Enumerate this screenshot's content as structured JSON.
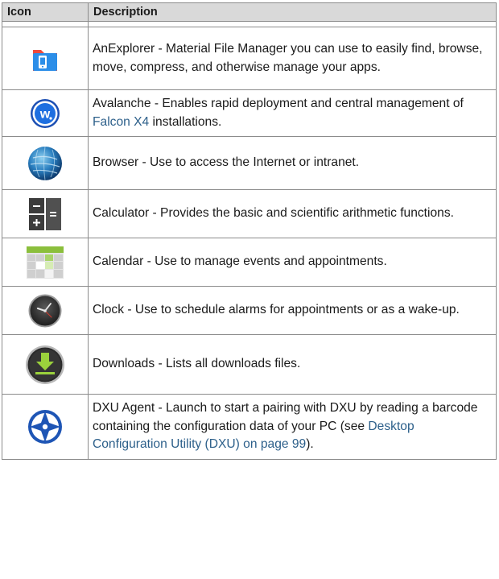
{
  "table": {
    "headers": {
      "icon": "Icon",
      "description": "Description"
    },
    "rows": [
      {
        "icon": "file-manager-icon",
        "text": "AnExplorer - Material File Manager you can use to easily find, browse, move, compress, and otherwise manage your apps."
      },
      {
        "icon": "avalanche-icon",
        "text_before": "Avalanche - Enables rapid deployment and central management of ",
        "link": "Falcon X4",
        "text_after": " installations."
      },
      {
        "icon": "globe-icon",
        "text": "Browser - Use to access the Internet or intranet."
      },
      {
        "icon": "calculator-icon",
        "text": "Calculator - Provides the basic and scientific arithmetic functions."
      },
      {
        "icon": "calendar-icon",
        "text": "Calendar - Use to manage events and appointments."
      },
      {
        "icon": "clock-icon",
        "text": "Clock - Use to schedule alarms for appointments or as a wake-up."
      },
      {
        "icon": "download-icon",
        "text": "Downloads - Lists all downloads files."
      },
      {
        "icon": "dxu-agent-icon",
        "text_before": "DXU Agent - Launch to start a pairing with DXU by reading a barcode containing the configuration data of your PC (see ",
        "link": "Desktop Configuration Utility (DXU) on page 99",
        "text_after": ")."
      }
    ]
  }
}
